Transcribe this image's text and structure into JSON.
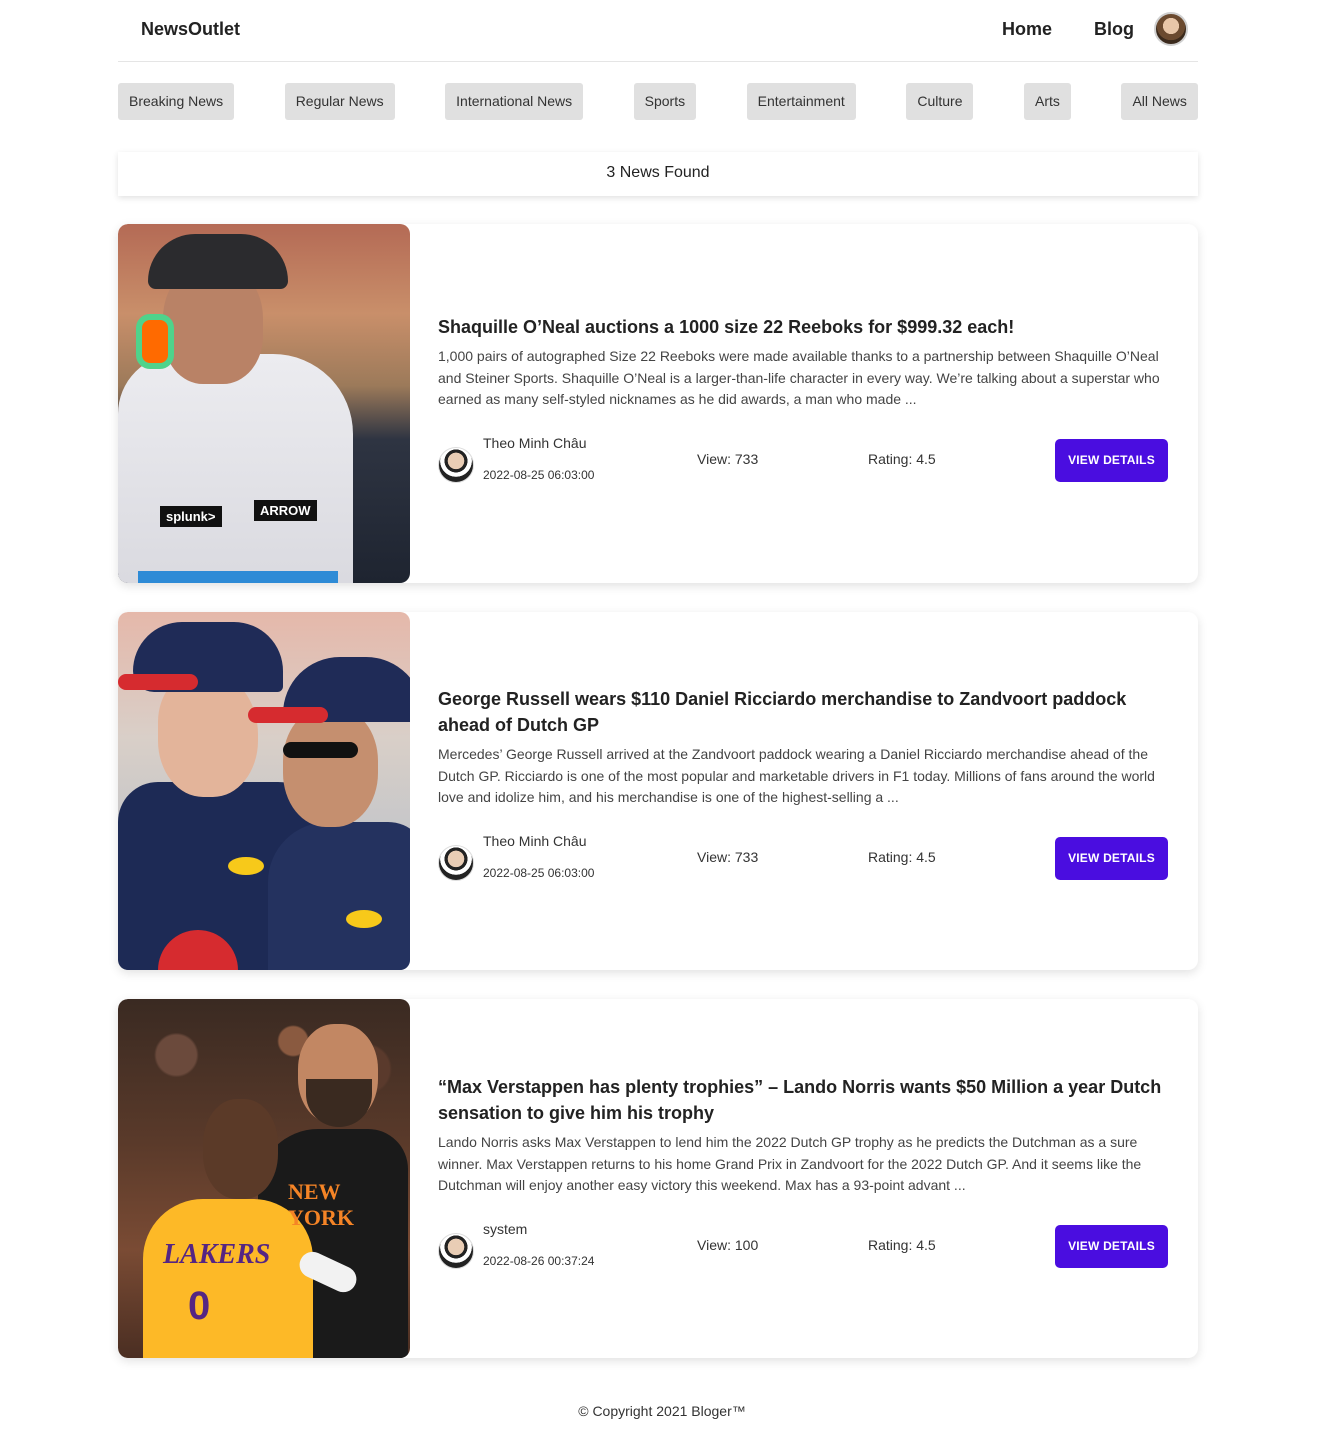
{
  "header": {
    "brand": "NewsOutlet",
    "nav": [
      {
        "label": "Home"
      },
      {
        "label": "Blog"
      }
    ]
  },
  "categories": [
    {
      "label": "Breaking News"
    },
    {
      "label": "Regular News"
    },
    {
      "label": "International News"
    },
    {
      "label": "Sports"
    },
    {
      "label": "Entertainment"
    },
    {
      "label": "Culture"
    },
    {
      "label": "Arts"
    },
    {
      "label": "All News"
    }
  ],
  "results": {
    "label": "3 News Found"
  },
  "news": [
    {
      "title": "Shaquille O’Neal auctions a 1000 size 22 Reeboks for $999.32 each!",
      "description": "1,000 pairs of autographed Size 22 Reeboks were made available thanks to a partnership between Shaquille O’Neal and Steiner Sports. Shaquille O’Neal is a larger-than-life character in every way. We’re talking about a superstar who earned as many self-styled nicknames as he did awards, a man who made ...",
      "author": "Theo Minh Châu",
      "date": "2022-08-25 06:03:00",
      "views": "View: 733",
      "rating": "Rating: 4.5",
      "button": "VIEW DETAILS",
      "image_logos": [
        "splunk>",
        "ARROW"
      ]
    },
    {
      "title": "George Russell wears $110 Daniel Ricciardo merchandise to Zandvoort paddock ahead of Dutch GP",
      "description": "Mercedes’ George Russell arrived at the Zandvoort paddock wearing a Daniel Ricciardo merchandise ahead of the Dutch GP. Ricciardo is one of the most popular and marketable drivers in F1 today. Millions of fans around the world love and idolize him, and his merchandise is one of the highest-selling a ...",
      "author": "Theo Minh Châu",
      "date": "2022-08-25 06:03:00",
      "views": "View: 733",
      "rating": "Rating: 4.5",
      "button": "VIEW DETAILS"
    },
    {
      "title": "“Max Verstappen has plenty trophies” – Lando Norris wants $50 Million a year Dutch sensation to give him his trophy",
      "description": "Lando Norris asks Max Verstappen to lend him the 2022 Dutch GP trophy as he predicts the Dutchman as a sure winner. Max Verstappen returns to his home Grand Prix in Zandvoort for the 2022 Dutch GP. And it seems like the Dutchman will enjoy another easy victory this weekend. Max has a 93-point advant ...",
      "author": "system",
      "date": "2022-08-26 00:37:24",
      "views": "View: 100",
      "rating": "Rating: 4.5",
      "button": "VIEW DETAILS",
      "image_text": [
        "LAKERS",
        "0",
        "NEW YORK"
      ]
    }
  ],
  "footer": {
    "copyright": "© Copyright 2021 Bloger™"
  },
  "colors": {
    "button": "#4a0de0",
    "category_bg": "#e0e0e0"
  }
}
